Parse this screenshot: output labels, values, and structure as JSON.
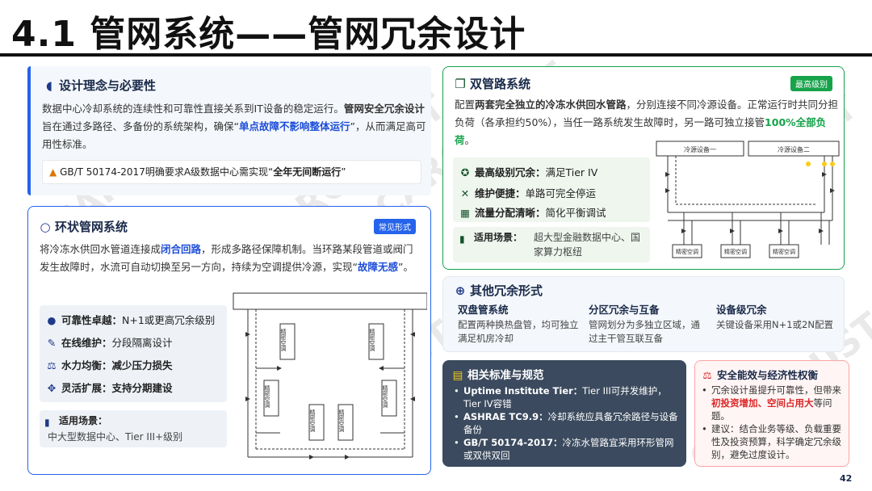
{
  "title": "4.1 管网系统——管网冗余设计",
  "page_number": "42",
  "watermark": "CARC-HUST",
  "colors": {
    "blue_accent": "#2563eb",
    "green_accent": "#16a34a",
    "red": "#dc2626",
    "dark_panel": "#3b4a5e"
  },
  "design": {
    "title": "设计理念与必要性",
    "p1": "数据中心冷却系统的连续性和可靠性直接关系到IT设备的稳定运行。",
    "p1_bold": "管网安全冗余设计",
    "p2": "旨在通过多路径、多备份的系统架构，确保“",
    "p2_highlight": "单点故障不影响整体运行",
    "p3": "”，从而满足高可用性标准。",
    "note_pre": "GB/T 50174-2017明确要求A级数据中心需实现“",
    "note_bold": "全年无间断运行",
    "note_post": "”"
  },
  "ring": {
    "title": "环状管网系统",
    "badge": "常见形式",
    "p1": "将冷冻水供回水管道连接成",
    "p1_bold": "闭合回路",
    "p2": "，形成多路径保障机制。当环路某段管道或阀门发生故障时，水流可自动切换至另一方向，持续为空调提供冷源，实现“",
    "p2_bold": "故障无感",
    "p3": "”。",
    "features": [
      {
        "label": "可靠性卓越：",
        "text": "N+1或更高冗余级别"
      },
      {
        "label": "在线维护：",
        "text": "分段隔离设计"
      },
      {
        "label": "水力均衡：",
        "text": "减少压力损失"
      },
      {
        "label": "灵活扩展：",
        "text": "支持分期建设"
      }
    ],
    "scene_label": "适用场景：",
    "scene_text": "中大型数据中心、Tier III+级别",
    "unit_label": "精密空调"
  },
  "dual": {
    "title": "双管路系统",
    "badge": "最高级别",
    "p1": "配置",
    "p1_bold": "两套完全独立的冷冻水供回水管路",
    "p2": "，分别连接不同冷源设备。正常运行时共同分担负荷（各承担约50%），当任一路系统发生故障时，另一路可独立接管",
    "p2_green": "100%全部负荷",
    "p3": "。",
    "features": [
      {
        "label": "最高级别冗余：",
        "text": "满足Tier IV"
      },
      {
        "label": "维护便捷：",
        "text": "单路可完全停运"
      },
      {
        "label": "流量分配清晰：",
        "text": "简化平衡调试"
      }
    ],
    "scene_label": "适用场景：",
    "scene_text": "超大型金融数据中心、国家算力枢纽",
    "cold_source_1": "冷源设备一",
    "cold_source_2": "冷源设备二",
    "unit_label": "精密空调"
  },
  "other": {
    "title": "其他冗余形式",
    "items": [
      {
        "title": "双盘管系统",
        "text": "配置两种换热盘管，均可独立满足机房冷却"
      },
      {
        "title": "分区冗余与互备",
        "text": "管网划分为多独立区域，通过主干管互联互备"
      },
      {
        "title": "设备级冗余",
        "text": "关键设备采用N+1或2N配置"
      }
    ]
  },
  "standards": {
    "title": "相关标准与规范",
    "items": [
      {
        "label": "Uptime Institute Tier：",
        "text": "Tier III可并发维护，Tier IV容错"
      },
      {
        "label": "ASHRAE TC9.9：",
        "text": "冷却系统应具备冗余路径与设备备份"
      },
      {
        "label": "GB/T 50174-2017：",
        "text": "冷冻水管路宜采用环形管网或双供双回"
      }
    ]
  },
  "balance": {
    "title": "安全能效与经济性权衡",
    "b1_pre": "冗余设计虽提升可靠性，但带来",
    "b1_red": "初投资增加、空间占用大",
    "b1_post": "等问题。",
    "b2": "建议：结合业务等级、负载重要性及投资预算，科学确定冗余级别，避免过度设计。"
  }
}
